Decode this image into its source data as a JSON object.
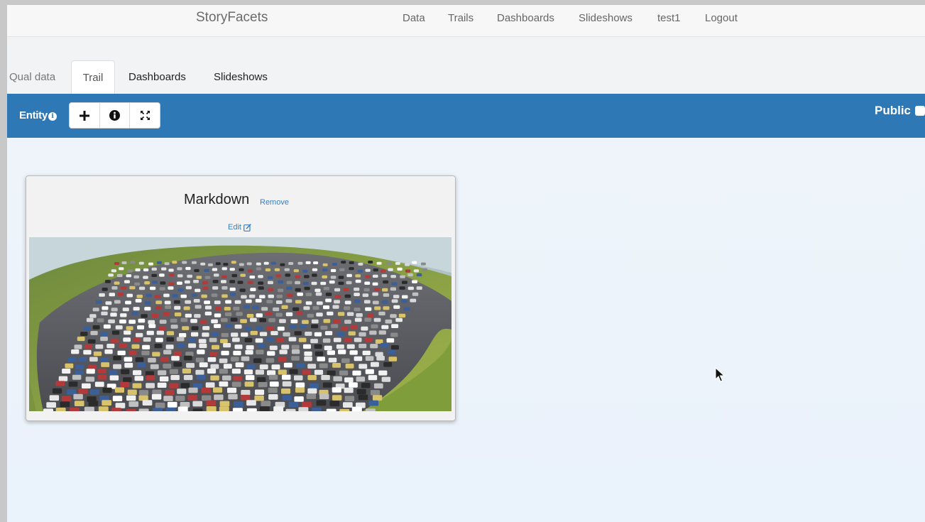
{
  "app": {
    "brand": "StoryFacets"
  },
  "nav": {
    "items": [
      {
        "label": "Data"
      },
      {
        "label": "Trails"
      },
      {
        "label": "Dashboards"
      },
      {
        "label": "Slideshows"
      },
      {
        "label": "test1"
      },
      {
        "label": "Logout"
      }
    ]
  },
  "tabs": {
    "qual": "Qual data",
    "trail": "Trail",
    "dashboards": "Dashboards",
    "slideshows": "Slideshows",
    "active": "Trail"
  },
  "toolbar": {
    "entity_label": "Entity",
    "entity_info_glyph": "i",
    "buttons": [
      {
        "icon": "plus-icon"
      },
      {
        "icon": "info-circle-icon"
      },
      {
        "icon": "fullscreen-icon"
      }
    ],
    "public_label": "Public",
    "public_checked": false
  },
  "card": {
    "title": "Markdown",
    "remove_label": "Remove",
    "edit_label": "Edit",
    "image_icon": "traffic-jam-photo"
  },
  "colors": {
    "toolbar": "#2f78b6",
    "link": "#3a7fc1",
    "canvas": "#eef4fa"
  }
}
